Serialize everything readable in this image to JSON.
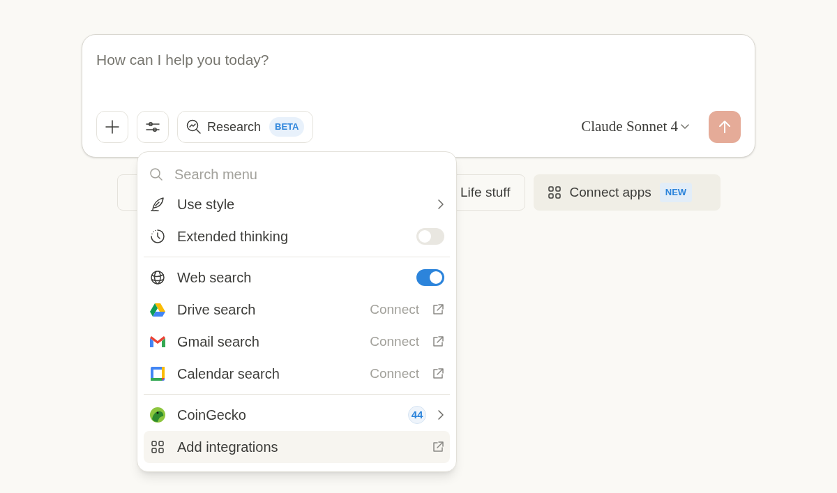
{
  "composer": {
    "placeholder": "How can I help you today?",
    "research": {
      "label": "Research",
      "badge": "BETA"
    },
    "model": "Claude Sonnet 4",
    "send_disabled": true
  },
  "chips": [
    {
      "label": "Life stuff"
    },
    {
      "label": "Connect apps",
      "badge": "NEW"
    }
  ],
  "menu": {
    "search_placeholder": "Search menu",
    "groups": [
      [
        {
          "kind": "submenu",
          "label": "Use style"
        },
        {
          "kind": "toggle",
          "label": "Extended thinking",
          "on": false
        }
      ],
      [
        {
          "kind": "toggle",
          "label": "Web search",
          "on": true
        },
        {
          "kind": "connect",
          "label": "Drive search",
          "action": "Connect"
        },
        {
          "kind": "connect",
          "label": "Gmail search",
          "action": "Connect"
        },
        {
          "kind": "connect",
          "label": "Calendar search",
          "action": "Connect"
        }
      ],
      [
        {
          "kind": "submenu",
          "label": "CoinGecko",
          "count": "44"
        },
        {
          "kind": "link",
          "label": "Add integrations",
          "highlighted": true
        }
      ]
    ]
  }
}
